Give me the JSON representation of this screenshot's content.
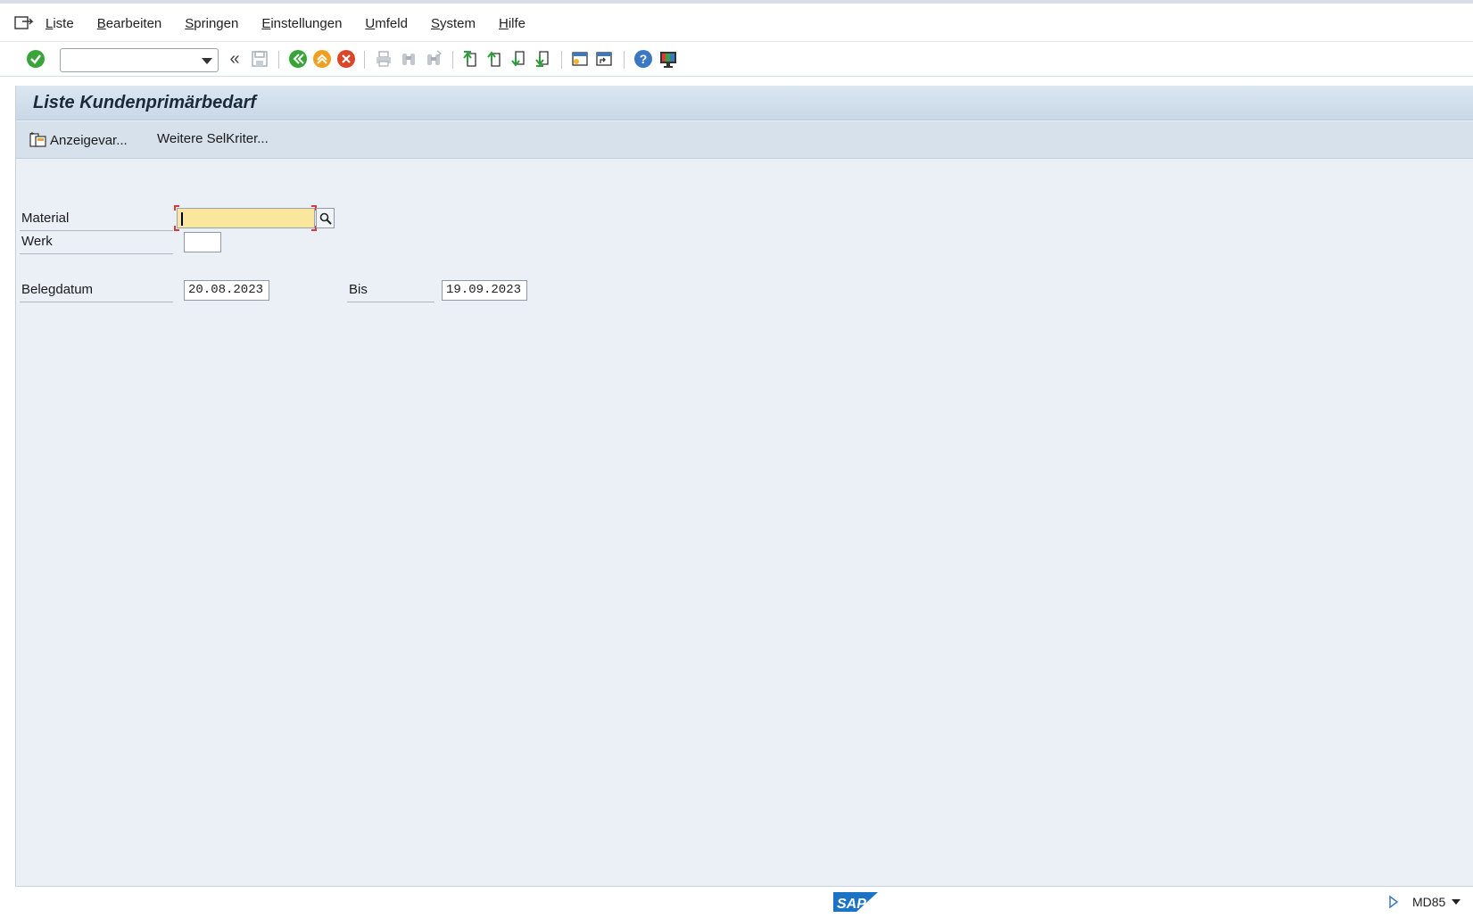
{
  "menu": {
    "items": [
      {
        "first": "L",
        "rest": "iste"
      },
      {
        "first": "B",
        "rest": "earbeiten"
      },
      {
        "first": "S",
        "rest": "pringen"
      },
      {
        "first": "E",
        "rest": "instellungen"
      },
      {
        "first": "U",
        "rest": "mfeld"
      },
      {
        "first": "S",
        "rest": "ystem"
      },
      {
        "first": "H",
        "rest": "ilfe"
      }
    ]
  },
  "toolbar": {
    "command_field_value": "",
    "back_double": "«"
  },
  "screen": {
    "title": "Liste Kundenprimärbedarf",
    "app_buttons": {
      "display_variant": "Anzeigevar...",
      "more_selection": "Weitere SelKriter..."
    }
  },
  "form": {
    "material_label": "Material",
    "material_value": "",
    "plant_label": "Werk",
    "plant_value": "",
    "doc_date_label": "Belegdatum",
    "doc_date_from": "20.08.2023",
    "to_label": "Bis",
    "doc_date_to": "19.09.2023"
  },
  "status": {
    "logo_text": "SAP",
    "transaction": "MD85"
  },
  "colors": {
    "background": "#eaf0f6",
    "required_field": "#fbe69e",
    "enter_green": "#3aa33a",
    "exit_orange": "#f0a020",
    "cancel_red": "#d9462a",
    "sap_blue": "#1a73c4"
  }
}
